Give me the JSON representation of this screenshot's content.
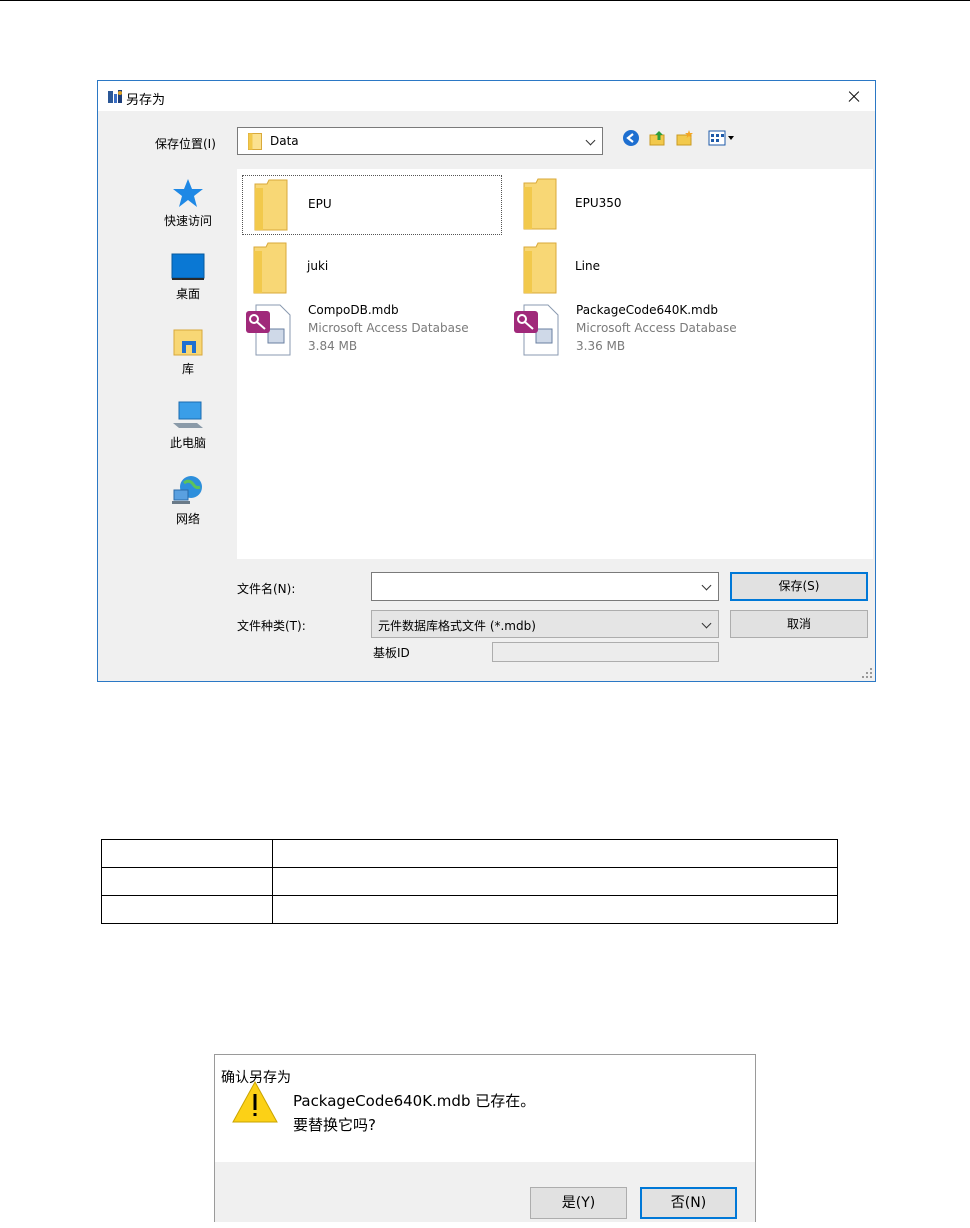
{
  "save_dialog": {
    "title": "另存为",
    "save_in_label": "保存位置(I)",
    "save_in_value": "Data",
    "places": [
      {
        "label": "快速访问",
        "icon": "star-icon"
      },
      {
        "label": "桌面",
        "icon": "desktop-icon"
      },
      {
        "label": "库",
        "icon": "library-icon"
      },
      {
        "label": "此电脑",
        "icon": "computer-icon"
      },
      {
        "label": "网络",
        "icon": "network-icon"
      }
    ],
    "files": [
      {
        "name": "EPU",
        "kind": "folder"
      },
      {
        "name": "EPU350",
        "kind": "folder"
      },
      {
        "name": "juki",
        "kind": "folder"
      },
      {
        "name": "Line",
        "kind": "folder"
      },
      {
        "name": "CompoDB.mdb",
        "kind": "access-db",
        "type": "Microsoft Access Database",
        "size": "3.84 MB"
      },
      {
        "name": "PackageCode640K.mdb",
        "kind": "access-db",
        "type": "Microsoft Access Database",
        "size": "3.36 MB"
      }
    ],
    "filename_label": "文件名(N):",
    "filename_value": "",
    "filetype_label": "文件种类(T):",
    "filetype_value": "元件数据库格式文件 (*.mdb)",
    "board_id_label": "基板ID",
    "board_id_value": "",
    "save_button": "保存(S)",
    "cancel_button": "取消"
  },
  "confirm_dialog": {
    "title": "确认另存为",
    "message_line1": "PackageCode640K.mdb 已存在。",
    "message_line2": "要替换它吗?",
    "yes_button": "是(Y)",
    "no_button": "否(N)"
  },
  "colors": {
    "dialog_bg": "#f0f0f0",
    "accent_border": "#0078d7",
    "folder_yellow": "#f8d775",
    "warning_yellow": "#fcd116"
  }
}
